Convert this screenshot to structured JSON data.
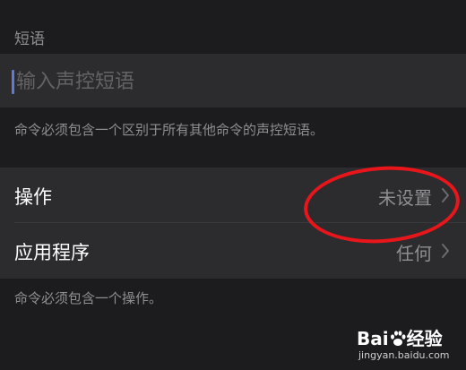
{
  "phrase_section": {
    "header": "短语",
    "input_placeholder": "输入声控短语",
    "input_value": "",
    "footer": "命令必须包含一个区别于所有其他命令的声控短语。"
  },
  "settings_group": {
    "rows": [
      {
        "label": "操作",
        "value": "未设置"
      },
      {
        "label": "应用程序",
        "value": "任何"
      }
    ],
    "footer": "命令必须包含一个操作。"
  },
  "icons": {
    "disclosure": "chevron-right-icon",
    "watermark": "baidu-paw-icon"
  },
  "watermark": {
    "brand_left": "Bai",
    "brand_right": "经验",
    "url": "jingyan.baidu.com"
  },
  "colors": {
    "background": "#1c1c1e",
    "cell": "#2c2c2e",
    "secondary_text": "#8e8e93",
    "caret": "#5e7bd9",
    "annotation": "#e8161b"
  }
}
